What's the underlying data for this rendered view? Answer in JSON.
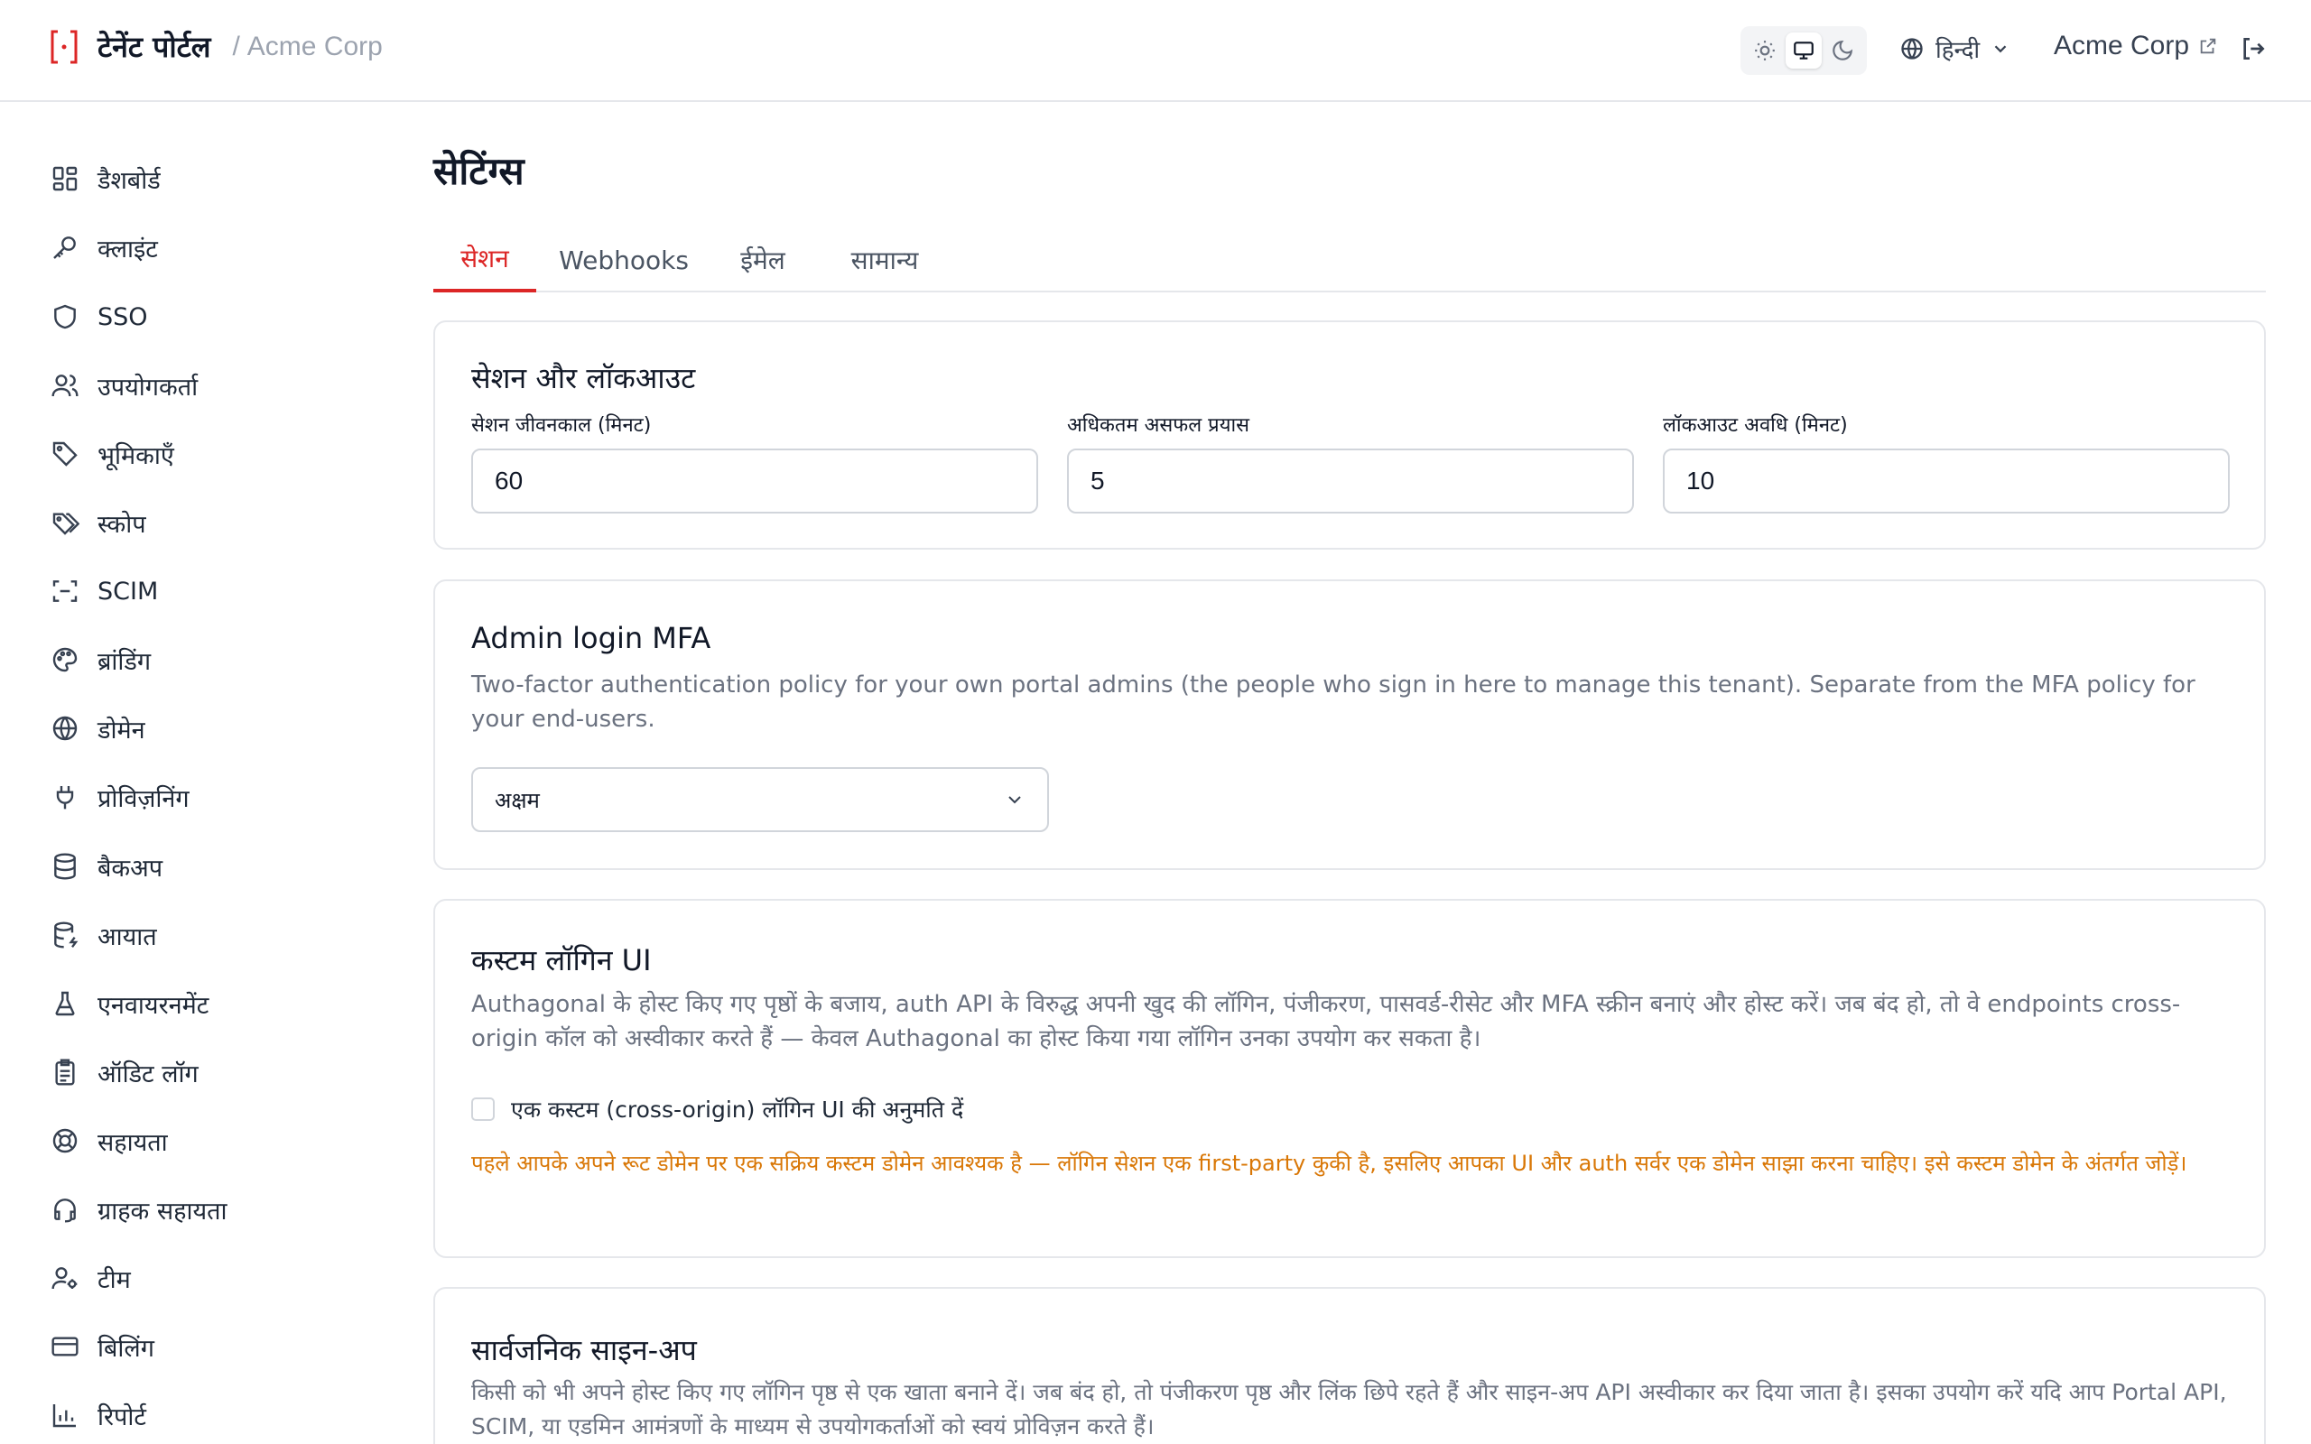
{
  "header": {
    "brand_name": "टेनेंट पोर्टल",
    "separator": "/",
    "tenant": "Acme Corp",
    "language": "हिन्दी",
    "tenant_link": "Acme Corp"
  },
  "sidebar": {
    "items": [
      {
        "label": "डैशबोर्ड",
        "icon": "dashboard-icon"
      },
      {
        "label": "क्लाइंट",
        "icon": "key-icon"
      },
      {
        "label": "SSO",
        "icon": "shield-icon"
      },
      {
        "label": "उपयोगकर्ता",
        "icon": "users-icon"
      },
      {
        "label": "भूमिकाएँ",
        "icon": "tag-icon"
      },
      {
        "label": "स्कोप",
        "icon": "tags-icon"
      },
      {
        "label": "SCIM",
        "icon": "scan-icon"
      },
      {
        "label": "ब्रांडिंग",
        "icon": "palette-icon"
      },
      {
        "label": "डोमेन",
        "icon": "globe-icon"
      },
      {
        "label": "प्रोविज़निंग",
        "icon": "plug-icon"
      },
      {
        "label": "बैकअप",
        "icon": "database-icon"
      },
      {
        "label": "आयात",
        "icon": "database-import-icon"
      },
      {
        "label": "एनवायरनमेंट",
        "icon": "flask-icon"
      },
      {
        "label": "ऑडिट लॉग",
        "icon": "clipboard-icon"
      },
      {
        "label": "सहायता",
        "icon": "lifebuoy-icon"
      },
      {
        "label": "ग्राहक सहायता",
        "icon": "headset-icon"
      },
      {
        "label": "टीम",
        "icon": "user-cog-icon"
      },
      {
        "label": "बिलिंग",
        "icon": "credit-card-icon"
      },
      {
        "label": "रिपोर्ट",
        "icon": "bar-chart-icon"
      }
    ]
  },
  "main": {
    "title": "सेटिंग्स",
    "tabs": [
      "सेशन",
      "Webhooks",
      "ईमेल",
      "सामान्य"
    ],
    "active_tab": "सेशन",
    "session_card": {
      "title": "सेशन और लॉकआउट",
      "fields": [
        {
          "label": "सेशन जीवनकाल (मिनट)",
          "value": "60"
        },
        {
          "label": "अधिकतम असफल प्रयास",
          "value": "5"
        },
        {
          "label": "लॉकआउट अवधि (मिनट)",
          "value": "10"
        }
      ]
    },
    "mfa_card": {
      "title": "Admin login MFA",
      "description": "Two-factor authentication policy for your own portal admins (the people who sign in here to manage this tenant). Separate from the MFA policy for your end-users.",
      "select_value": "अक्षम"
    },
    "custom_login_card": {
      "title": "कस्टम लॉगिन UI",
      "description": "Authagonal के होस्ट किए गए पृष्ठों के बजाय, auth API के विरुद्ध अपनी खुद की लॉगिन, पंजीकरण, पासवर्ड-रीसेट और MFA स्क्रीन बनाएं और होस्ट करें। जब बंद हो, तो वे endpoints cross-origin कॉल को अस्वीकार करते हैं — केवल Authagonal का होस्ट किया गया लॉगिन उनका उपयोग कर सकता है।",
      "checkbox_label": "एक कस्टम (cross-origin) लॉगिन UI की अनुमति दें",
      "checkbox_checked": false,
      "warning": "पहले आपके अपने रूट डोमेन पर एक सक्रिय कस्टम डोमेन आवश्यक है — लॉगिन सेशन एक first-party कुकी है, इसलिए आपका UI और auth सर्वर एक डोमेन साझा करना चाहिए। इसे कस्टम डोमेन के अंतर्गत जोड़ें।"
    },
    "signup_card": {
      "title": "सार्वजनिक साइन-अप",
      "description": "किसी को भी अपने होस्ट किए गए लॉगिन पृष्ठ से एक खाता बनाने दें। जब बंद हो, तो पंजीकरण पृष्ठ और लिंक छिपे रहते हैं और साइन-अप API अस्वीकार कर दिया जाता है। इसका उपयोग करें यदि आप Portal API, SCIM, या एडमिन आमंत्रणों के माध्यम से उपयोगकर्ताओं को स्वयं प्रोविज़न करते हैं।"
    }
  },
  "colors": {
    "accent": "#dc2626",
    "warning": "#d97706",
    "border": "#e5e7eb"
  }
}
